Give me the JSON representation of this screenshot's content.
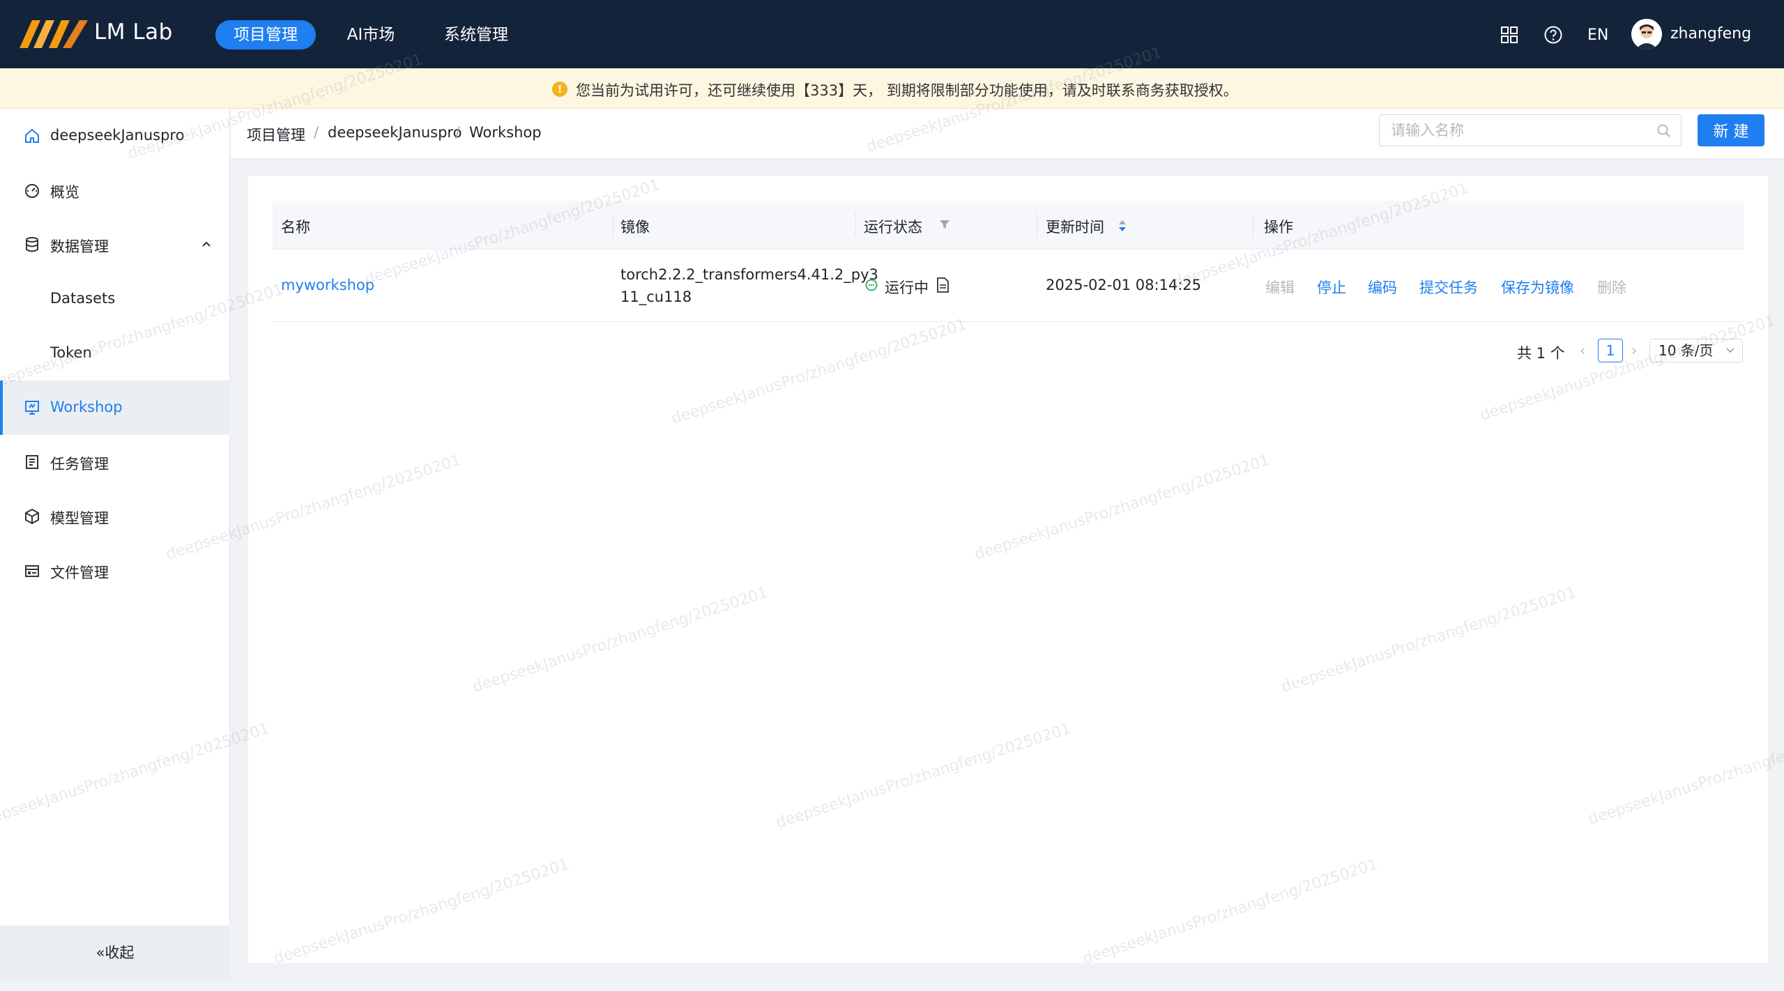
{
  "topbar": {
    "brand": "LM Lab",
    "nav": [
      "项目管理",
      "AI市场",
      "系统管理"
    ],
    "active_nav": "项目管理",
    "language": "EN",
    "username": "zhangfeng",
    "brand_color": "#1f7ef0"
  },
  "banner": {
    "text": "您当前为试用许可，还可继续使用【333】天， 到期将限制部分功能使用，请及时联系商务获取授权。"
  },
  "sidebar": {
    "project": "deepseekJanuspro",
    "items": [
      {
        "label": "概览",
        "icon": "dashboard-icon"
      },
      {
        "label": "数据管理",
        "icon": "database-icon"
      },
      {
        "label": "Datasets",
        "icon": ""
      },
      {
        "label": "Token",
        "icon": ""
      },
      {
        "label": "Workshop",
        "icon": "workshop-icon"
      },
      {
        "label": "任务管理",
        "icon": "task-icon"
      },
      {
        "label": "模型管理",
        "icon": "model-icon"
      },
      {
        "label": "文件管理",
        "icon": "file-icon"
      }
    ],
    "active": "Workshop",
    "collapse_label": "«收起"
  },
  "breadcrumb": [
    "项目管理",
    "deepseekJanuspro",
    "Workshop"
  ],
  "search": {
    "placeholder": "请输入名称",
    "value": ""
  },
  "new_button": "新 建",
  "table": {
    "columns": [
      "名称",
      "镜像",
      "运行状态",
      "更新时间",
      "操作"
    ],
    "rows": [
      {
        "name": "myworkshop",
        "image_line1": "torch2.2.2_transformers4.41.2_py3",
        "image_line2": "11_cu118",
        "status": "运行中",
        "updated": "2025-02-01 08:14:25",
        "actions": {
          "edit": "编辑",
          "stop": "停止",
          "code": "编码",
          "submit": "提交任务",
          "save_image": "保存为镜像",
          "delete": "删除"
        }
      }
    ]
  },
  "pagination": {
    "total": "共 1 个",
    "current": "1",
    "page_size": "10 条/页"
  },
  "watermark": "deepseekJanusPro/zhangfeng/20250201"
}
